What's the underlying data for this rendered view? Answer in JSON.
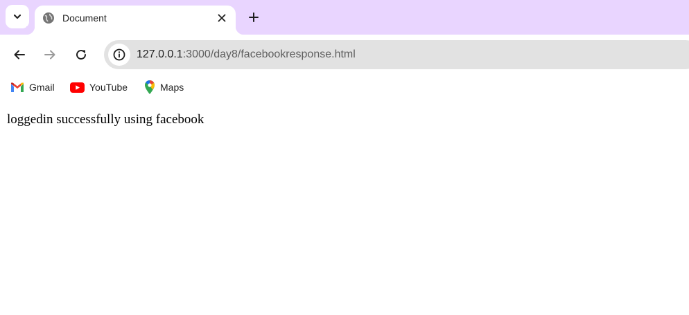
{
  "tab": {
    "title": "Document",
    "favicon": "globe-icon"
  },
  "toolbar": {
    "back_icon": "arrow-left-icon",
    "forward_icon": "arrow-right-icon",
    "reload_icon": "reload-icon",
    "url_host": "127.0.0.1",
    "url_rest": ":3000/day8/facebookresponse.html"
  },
  "bookmarks": [
    {
      "label": "Gmail",
      "icon": "gmail-icon"
    },
    {
      "label": "YouTube",
      "icon": "youtube-icon"
    },
    {
      "label": "Maps",
      "icon": "maps-icon"
    }
  ],
  "page": {
    "message": "loggedin successfully using facebook"
  },
  "colors": {
    "tabstrip": "#e9d5ff",
    "omnibox": "#e2e2e2"
  }
}
